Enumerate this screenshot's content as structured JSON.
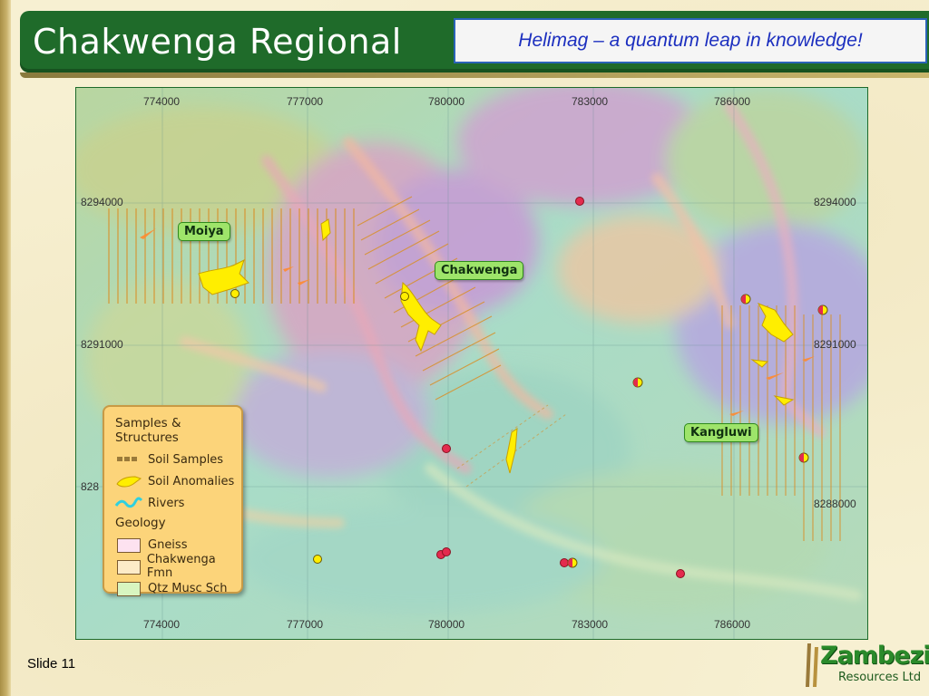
{
  "slide": {
    "title": "Chakwenga Regional",
    "tagline": "Helimag – a quantum leap in knowledge!",
    "slide_number": "Slide 11"
  },
  "map": {
    "x_coords_top": [
      "774000",
      "777000",
      "780000",
      "783000",
      "786000"
    ],
    "x_coords_bottom": [
      "774000",
      "777000",
      "780000",
      "783000",
      "786000"
    ],
    "y_coords_left": [
      "8294000",
      "8291000",
      "828"
    ],
    "y_coords_right": [
      "8294000",
      "8291000",
      "8288000"
    ],
    "place_labels": {
      "moiya": "Moiya",
      "chakwenga": "Chakwenga",
      "kangluwi": "Kangluwi"
    }
  },
  "legend": {
    "title": "Samples & Structures",
    "items": {
      "soil_samples": "Soil Samples",
      "soil_anomalies": "Soil Anomalies",
      "rivers": "Rivers"
    },
    "geology_title": "Geology",
    "geology": {
      "gneiss": "Gneiss",
      "chakwenga_fmn": "Chakwenga Fmn",
      "qtz_musc_sch": "Qtz Musc Sch"
    }
  },
  "logo": {
    "name": "Zambezi",
    "subtitle": "Resources Ltd"
  },
  "colors": {
    "title_bar": "#1f6b2a",
    "tagline_text": "#1c2fbf",
    "anomaly_fill": "#ffee00",
    "sample_lines": "#d8902a",
    "legend_bg": "#fcd47a",
    "gneiss": "#fde2f0",
    "chakwenga_fmn": "#fdebc8",
    "qtz_musc_sch": "#d8f5c0"
  }
}
